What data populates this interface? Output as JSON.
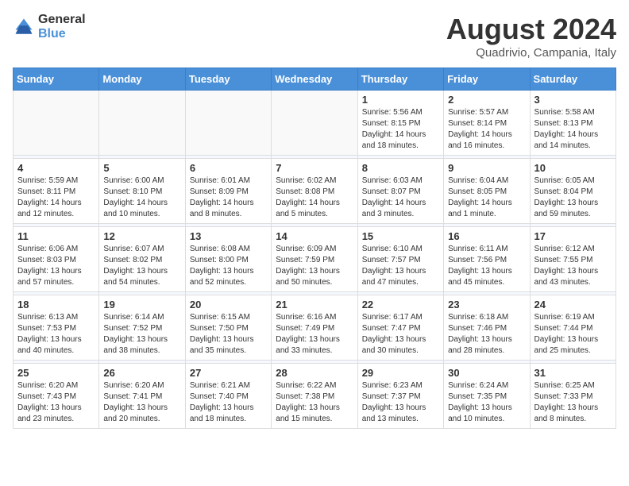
{
  "logo": {
    "general": "General",
    "blue": "Blue"
  },
  "header": {
    "title": "August 2024",
    "subtitle": "Quadrivio, Campania, Italy"
  },
  "days_of_week": [
    "Sunday",
    "Monday",
    "Tuesday",
    "Wednesday",
    "Thursday",
    "Friday",
    "Saturday"
  ],
  "weeks": [
    {
      "days": [
        {
          "num": "",
          "info": "",
          "empty": true
        },
        {
          "num": "",
          "info": "",
          "empty": true
        },
        {
          "num": "",
          "info": "",
          "empty": true
        },
        {
          "num": "",
          "info": "",
          "empty": true
        },
        {
          "num": "1",
          "info": "Sunrise: 5:56 AM\nSunset: 8:15 PM\nDaylight: 14 hours\nand 18 minutes."
        },
        {
          "num": "2",
          "info": "Sunrise: 5:57 AM\nSunset: 8:14 PM\nDaylight: 14 hours\nand 16 minutes."
        },
        {
          "num": "3",
          "info": "Sunrise: 5:58 AM\nSunset: 8:13 PM\nDaylight: 14 hours\nand 14 minutes."
        }
      ]
    },
    {
      "days": [
        {
          "num": "4",
          "info": "Sunrise: 5:59 AM\nSunset: 8:11 PM\nDaylight: 14 hours\nand 12 minutes."
        },
        {
          "num": "5",
          "info": "Sunrise: 6:00 AM\nSunset: 8:10 PM\nDaylight: 14 hours\nand 10 minutes."
        },
        {
          "num": "6",
          "info": "Sunrise: 6:01 AM\nSunset: 8:09 PM\nDaylight: 14 hours\nand 8 minutes."
        },
        {
          "num": "7",
          "info": "Sunrise: 6:02 AM\nSunset: 8:08 PM\nDaylight: 14 hours\nand 5 minutes."
        },
        {
          "num": "8",
          "info": "Sunrise: 6:03 AM\nSunset: 8:07 PM\nDaylight: 14 hours\nand 3 minutes."
        },
        {
          "num": "9",
          "info": "Sunrise: 6:04 AM\nSunset: 8:05 PM\nDaylight: 14 hours\nand 1 minute."
        },
        {
          "num": "10",
          "info": "Sunrise: 6:05 AM\nSunset: 8:04 PM\nDaylight: 13 hours\nand 59 minutes."
        }
      ]
    },
    {
      "days": [
        {
          "num": "11",
          "info": "Sunrise: 6:06 AM\nSunset: 8:03 PM\nDaylight: 13 hours\nand 57 minutes."
        },
        {
          "num": "12",
          "info": "Sunrise: 6:07 AM\nSunset: 8:02 PM\nDaylight: 13 hours\nand 54 minutes."
        },
        {
          "num": "13",
          "info": "Sunrise: 6:08 AM\nSunset: 8:00 PM\nDaylight: 13 hours\nand 52 minutes."
        },
        {
          "num": "14",
          "info": "Sunrise: 6:09 AM\nSunset: 7:59 PM\nDaylight: 13 hours\nand 50 minutes."
        },
        {
          "num": "15",
          "info": "Sunrise: 6:10 AM\nSunset: 7:57 PM\nDaylight: 13 hours\nand 47 minutes."
        },
        {
          "num": "16",
          "info": "Sunrise: 6:11 AM\nSunset: 7:56 PM\nDaylight: 13 hours\nand 45 minutes."
        },
        {
          "num": "17",
          "info": "Sunrise: 6:12 AM\nSunset: 7:55 PM\nDaylight: 13 hours\nand 43 minutes."
        }
      ]
    },
    {
      "days": [
        {
          "num": "18",
          "info": "Sunrise: 6:13 AM\nSunset: 7:53 PM\nDaylight: 13 hours\nand 40 minutes."
        },
        {
          "num": "19",
          "info": "Sunrise: 6:14 AM\nSunset: 7:52 PM\nDaylight: 13 hours\nand 38 minutes."
        },
        {
          "num": "20",
          "info": "Sunrise: 6:15 AM\nSunset: 7:50 PM\nDaylight: 13 hours\nand 35 minutes."
        },
        {
          "num": "21",
          "info": "Sunrise: 6:16 AM\nSunset: 7:49 PM\nDaylight: 13 hours\nand 33 minutes."
        },
        {
          "num": "22",
          "info": "Sunrise: 6:17 AM\nSunset: 7:47 PM\nDaylight: 13 hours\nand 30 minutes."
        },
        {
          "num": "23",
          "info": "Sunrise: 6:18 AM\nSunset: 7:46 PM\nDaylight: 13 hours\nand 28 minutes."
        },
        {
          "num": "24",
          "info": "Sunrise: 6:19 AM\nSunset: 7:44 PM\nDaylight: 13 hours\nand 25 minutes."
        }
      ]
    },
    {
      "days": [
        {
          "num": "25",
          "info": "Sunrise: 6:20 AM\nSunset: 7:43 PM\nDaylight: 13 hours\nand 23 minutes."
        },
        {
          "num": "26",
          "info": "Sunrise: 6:20 AM\nSunset: 7:41 PM\nDaylight: 13 hours\nand 20 minutes."
        },
        {
          "num": "27",
          "info": "Sunrise: 6:21 AM\nSunset: 7:40 PM\nDaylight: 13 hours\nand 18 minutes."
        },
        {
          "num": "28",
          "info": "Sunrise: 6:22 AM\nSunset: 7:38 PM\nDaylight: 13 hours\nand 15 minutes."
        },
        {
          "num": "29",
          "info": "Sunrise: 6:23 AM\nSunset: 7:37 PM\nDaylight: 13 hours\nand 13 minutes."
        },
        {
          "num": "30",
          "info": "Sunrise: 6:24 AM\nSunset: 7:35 PM\nDaylight: 13 hours\nand 10 minutes."
        },
        {
          "num": "31",
          "info": "Sunrise: 6:25 AM\nSunset: 7:33 PM\nDaylight: 13 hours\nand 8 minutes."
        }
      ]
    }
  ]
}
